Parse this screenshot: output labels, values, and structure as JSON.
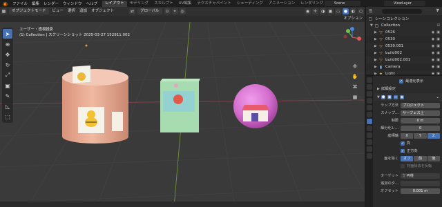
{
  "topbar": {
    "menus": [
      "ファイル",
      "編集",
      "レンダー",
      "ウィンドウ",
      "ヘルプ"
    ],
    "workspaces": [
      "レイアウト",
      "モデリング",
      "スカルプト",
      "UV編集",
      "テクスチャペイント",
      "シェーディング",
      "アニメーション",
      "レンダリング"
    ],
    "active_workspace": "レイアウト",
    "scene": "Scene",
    "view_layer": "ViewLayer"
  },
  "viewport_header": {
    "mode": "オブジェクトモード",
    "menus": [
      "ビュー",
      "選択",
      "追加",
      "オブジェクト"
    ],
    "transform_orientation": "グローバル",
    "options_label": "オプション"
  },
  "viewport_info": {
    "line1": "ユーザー・透視投影",
    "line2": "(1) Collection | スクリーンショット 2025-03-27 152911.002"
  },
  "outliner": {
    "title": "シーンコレクション",
    "collection": "Collection",
    "items": [
      {
        "name": "0526",
        "icon": "mesh-icon",
        "color": "#e08c3c"
      },
      {
        "name": "0530",
        "icon": "mesh-icon",
        "color": "#e08c3c"
      },
      {
        "name": "0530.001",
        "icon": "mesh-icon",
        "color": "#e08c3c"
      },
      {
        "name": "build002",
        "icon": "mesh-icon",
        "color": "#e08c3c"
      },
      {
        "name": "build002.001",
        "icon": "mesh-icon",
        "color": "#e08c3c"
      },
      {
        "name": "Camera",
        "icon": "camera-icon",
        "color": "#8ab4e8"
      },
      {
        "name": "Light",
        "icon": "light-icon",
        "color": "#e8d26c"
      }
    ]
  },
  "properties": {
    "always_show": "最適化表示",
    "advanced": "詳細設定",
    "wrap_method_label": "ラップ方法",
    "wrap_method": "プロジェクト",
    "snap_label": "スナップ...",
    "snap_value": "サーフェス上",
    "limit_label": "制限",
    "limit_value": "0 m",
    "subdiv_label": "細分化レ...",
    "subdiv_value": "0",
    "axis_label": "座標軸",
    "axes": [
      "X",
      "Y",
      "Z"
    ],
    "negative": "負",
    "positive": "正方向",
    "cull_label": "面を除く",
    "cull_options": [
      "オフ",
      "前",
      "後"
    ],
    "invert_cull": "背面除去を反転",
    "target_label": "ターゲット",
    "target_value": "円柱",
    "aux_target_label": "追加のタ...",
    "offset_label": "オフセット",
    "offset_value": "0.001 m"
  },
  "colors": {
    "accent": "#4772b3",
    "cylinder": "#e9ad92",
    "cube": "#a7dcb1",
    "sphere": "#d46fce"
  }
}
